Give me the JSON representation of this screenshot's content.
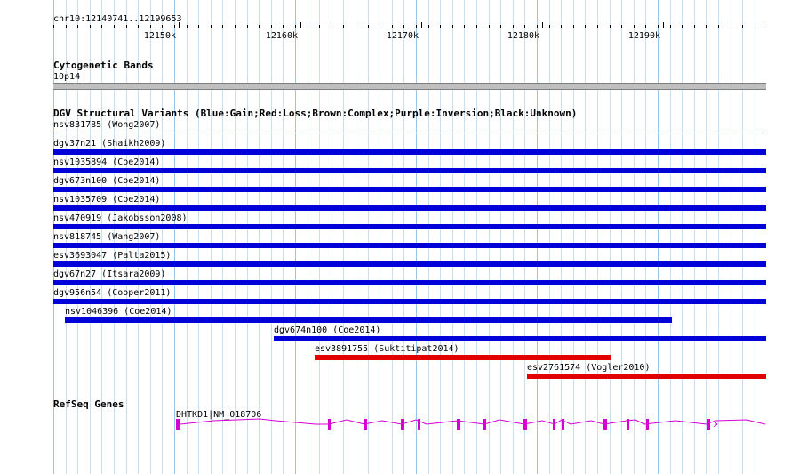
{
  "browser": {
    "position": "chr10:12140741..12199653",
    "ruler": {
      "ticks": [
        "12150k",
        "12160k",
        "12170k",
        "12180k",
        "12190k"
      ]
    },
    "colors": {
      "grid": "#c7e1f3",
      "gain": "#0000d8",
      "loss": "#e00000",
      "gene": "#d400d4",
      "band": "#bfbfbf"
    },
    "tracks": {
      "cytoband": {
        "title": "Cytogenetic Bands",
        "band_label": "10p14"
      },
      "dgv": {
        "title": "DGV Structural Variants (Blue:Gain;Red:Loss;Brown:Complex;Purple:Inversion;Black:Unknown)",
        "features": [
          {
            "label": "nsv831785 (Wong2007)",
            "type": "gain",
            "thin": true
          },
          {
            "label": "dgv37n21 (Shaikh2009)",
            "type": "gain"
          },
          {
            "label": "nsv1035894 (Coe2014)",
            "type": "gain"
          },
          {
            "label": "dgv673n100 (Coe2014)",
            "type": "gain"
          },
          {
            "label": "nsv1035709 (Coe2014)",
            "type": "gain"
          },
          {
            "label": "nsv470919 (Jakobsson2008)",
            "type": "gain"
          },
          {
            "label": "nsv818745 (Wang2007)",
            "type": "gain"
          },
          {
            "label": "esv3693047 (Palta2015)",
            "type": "gain"
          },
          {
            "label": "dgv67n27 (Itsara2009)",
            "type": "gain"
          },
          {
            "label": "dgv956n54 (Cooper2011)",
            "type": "gain"
          },
          {
            "label": "nsv1046396 (Coe2014)",
            "type": "gain"
          },
          {
            "label": "dgv674n100 (Coe2014)",
            "type": "gain"
          },
          {
            "label": "esv3891755 (Suktitipat2014)",
            "type": "loss"
          },
          {
            "label": "esv2761574 (Vogler2010)",
            "type": "loss"
          }
        ]
      },
      "refseq": {
        "title": "RefSeq Genes",
        "gene_label": "DHTKD1|NM_018706"
      }
    }
  }
}
